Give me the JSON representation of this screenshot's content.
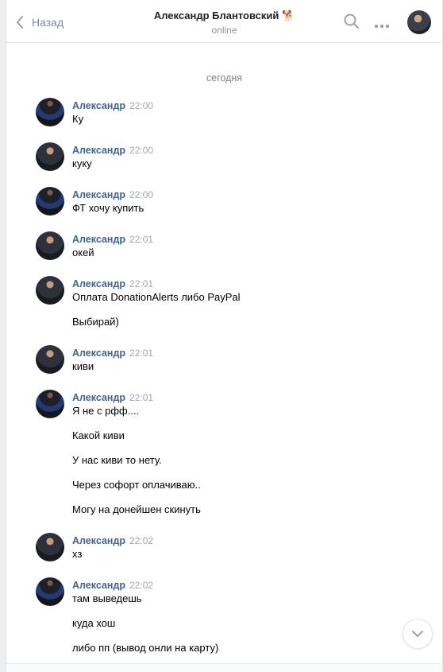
{
  "header": {
    "back_label": "Назад",
    "peer_name": "Александр Блантовский 🐕",
    "peer_status": "online"
  },
  "day_separator": "сегодня",
  "messages": [
    {
      "author": "Александр",
      "time": "22:00",
      "lines": [
        "Ку"
      ]
    },
    {
      "author": "Александр",
      "time": "22:00",
      "lines": [
        "куку"
      ]
    },
    {
      "author": "Александр",
      "time": "22:00",
      "lines": [
        "ФТ хочу купить"
      ]
    },
    {
      "author": "Александр",
      "time": "22:01",
      "lines": [
        "окей"
      ]
    },
    {
      "author": "Александр",
      "time": "22:01",
      "lines": [
        "Оплата DonationAlerts либо PayPal",
        "Выбирай)"
      ]
    },
    {
      "author": "Александр",
      "time": "22:01",
      "lines": [
        "киви"
      ]
    },
    {
      "author": "Александр",
      "time": "22:01",
      "lines": [
        "Я не с рфф....",
        "Какой киви",
        "У нас киви то нету.",
        "Через софорт оплачиваю..",
        "Могу на донейшен скинуть"
      ]
    },
    {
      "author": "Александр",
      "time": "22:02",
      "lines": [
        "хз"
      ]
    },
    {
      "author": "Александр",
      "time": "22:02",
      "lines": [
        "там выведешь",
        "куда хош",
        "либо пп (вывод онли на карту)"
      ]
    }
  ],
  "colors": {
    "author": "#42648b",
    "time": "#a0a6ae",
    "icon": "#99a2ad",
    "background": "#edeef0"
  },
  "icons": {
    "back": "chevron-left-icon",
    "search": "search-icon",
    "more": "more-horizontal-icon",
    "scroll_down": "chevron-down-icon"
  }
}
